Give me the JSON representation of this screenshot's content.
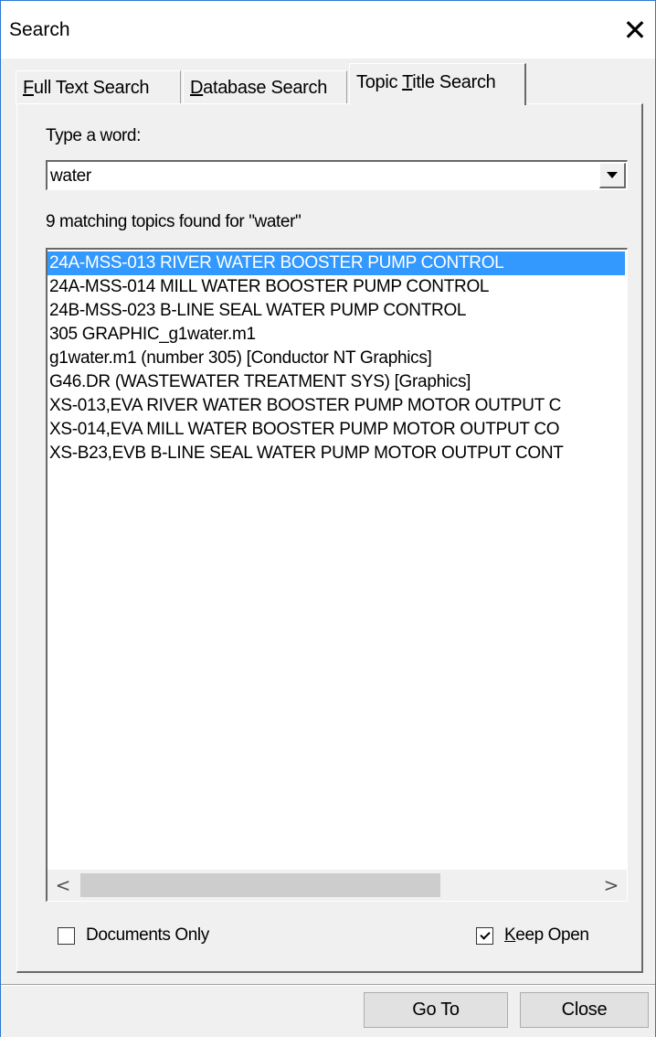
{
  "window": {
    "title": "Search",
    "close_glyph": "✕"
  },
  "tabs": [
    {
      "label_mnemonic": "F",
      "label_rest": "ull Text Search",
      "active": false
    },
    {
      "label_mnemonic": "D",
      "label_rest": "atabase Search",
      "active": false
    },
    {
      "label_pre": "Topic ",
      "label_mnemonic": "T",
      "label_rest": "itle Search",
      "active": true
    }
  ],
  "search": {
    "prompt_label": "Type a word:",
    "value": "water",
    "result_summary": "9 matching topics found for \"water\""
  },
  "results": [
    "24A-MSS-013 RIVER WATER BOOSTER PUMP CONTROL",
    "24A-MSS-014 MILL WATER BOOSTER PUMP CONTROL",
    "24B-MSS-023 B-LINE SEAL WATER PUMP CONTROL",
    "305 GRAPHIC_g1water.m1",
    "g1water.m1 (number 305) [Conductor NT Graphics]",
    "G46.DR (WASTEWATER TREATMENT SYS) [Graphics]",
    "XS-013,EVA RIVER WATER BOOSTER PUMP MOTOR OUTPUT C",
    "XS-014,EVA MILL WATER BOOSTER PUMP MOTOR OUTPUT CO",
    "XS-B23,EVB B-LINE SEAL WATER PUMP MOTOR OUTPUT CONT"
  ],
  "selected_index": 0,
  "scrollbar": {
    "left_glyph": "<",
    "right_glyph": ">"
  },
  "options": {
    "documents_only": {
      "label": "Documents Only",
      "checked": false
    },
    "keep_open": {
      "label_mnemonic": "K",
      "label_rest": "eep Open",
      "checked": true
    }
  },
  "buttons": {
    "go_to": "Go To",
    "close": "Close"
  },
  "colors": {
    "selection": "#3399ff",
    "window_border": "#2b79d0"
  }
}
